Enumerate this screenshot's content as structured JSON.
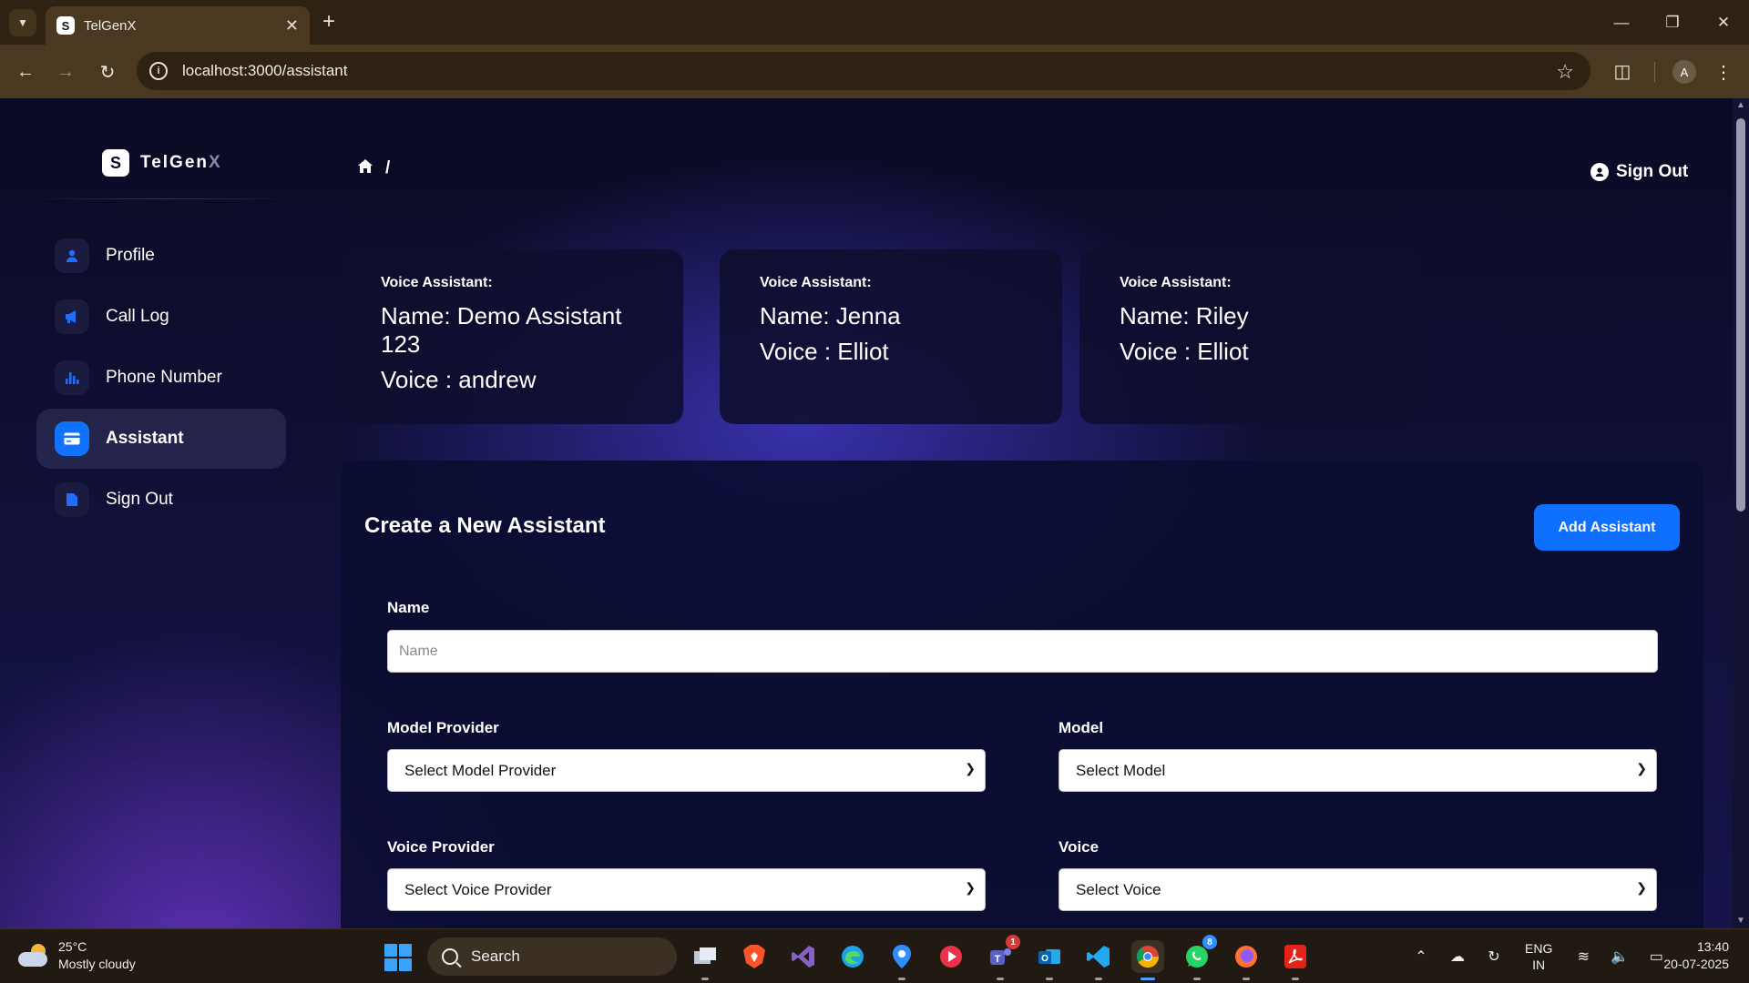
{
  "browser": {
    "tab_title": "TelGenX",
    "tab_favicon_letter": "S",
    "url": "localhost:3000/assistant",
    "profile_initial": "A"
  },
  "app": {
    "brand_logo_letter": "S",
    "brand_name_main": "TelGen",
    "brand_name_accent": "X",
    "accent_color": "#0f6fff",
    "breadcrumb_separator": "/",
    "signout_top_label": "Sign Out"
  },
  "sidebar": {
    "items": [
      {
        "label": "Profile",
        "icon": "person-icon",
        "active": false
      },
      {
        "label": "Call Log",
        "icon": "megaphone-icon",
        "active": false
      },
      {
        "label": "Phone Number",
        "icon": "bar-chart-icon",
        "active": false
      },
      {
        "label": "Assistant",
        "icon": "credit-card-icon",
        "active": true
      },
      {
        "label": "Sign Out",
        "icon": "document-icon",
        "active": false
      }
    ]
  },
  "assistants": [
    {
      "caption": "Voice Assistant:",
      "name_line": "Name: Demo Assistant 123",
      "voice_line": "Voice : andrew"
    },
    {
      "caption": "Voice Assistant:",
      "name_line": "Name: Jenna",
      "voice_line": "Voice : Elliot"
    },
    {
      "caption": "Voice Assistant:",
      "name_line": "Name: Riley",
      "voice_line": "Voice : Elliot"
    }
  ],
  "form": {
    "title": "Create a New Assistant",
    "add_button": "Add Assistant",
    "name_label": "Name",
    "name_placeholder": "Name",
    "name_value": "",
    "model_provider_label": "Model Provider",
    "model_provider_selected": "Select Model Provider",
    "model_label": "Model",
    "model_selected": "Select Model",
    "voice_provider_label": "Voice Provider",
    "voice_provider_selected": "Select Voice Provider",
    "voice_label": "Voice",
    "voice_selected": "Select Voice"
  },
  "taskbar": {
    "temperature": "25°C",
    "weather": "Mostly cloudy",
    "search_label": "Search",
    "teams_badge": "1",
    "whatsapp_badge": "8",
    "lang_top": "ENG",
    "lang_bottom": "IN",
    "time": "13:40",
    "date": "20-07-2025"
  }
}
